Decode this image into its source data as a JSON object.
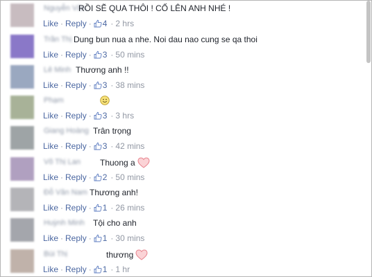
{
  "comments": [
    {
      "author": "Nguyễn Văn",
      "text": "RỒI SẼ QUA THÔI ! CỐ LÊN ANH NHÉ !",
      "like_label": "Like",
      "reply_label": "Reply",
      "likes": "4",
      "time": "2 hrs",
      "avatar_color": "#c8bcc0"
    },
    {
      "author": "Trần Thị",
      "text": "Dung bun nua a nhe. Noi dau nao cung se qa thoi",
      "like_label": "Like",
      "reply_label": "Reply",
      "likes": "3",
      "time": "50 mins",
      "avatar_color": "#8a78c8"
    },
    {
      "author": "Lê Minh",
      "text": "Thương anh !!",
      "like_label": "Like",
      "reply_label": "Reply",
      "likes": "3",
      "time": "38 mins",
      "avatar_color": "#9aa8c0"
    },
    {
      "author": "Phạm",
      "text": "",
      "emoji": "smile",
      "like_label": "Like",
      "reply_label": "Reply",
      "likes": "3",
      "time": "3 hrs",
      "avatar_color": "#a8b298"
    },
    {
      "author": "Giang Hoàng",
      "text": "Trân trọng",
      "like_label": "Like",
      "reply_label": "Reply",
      "likes": "3",
      "time": "42 mins",
      "avatar_color": "#9ea4a6"
    },
    {
      "author": "Võ Thị Lan",
      "text": "Thuong a",
      "emoji": "heart",
      "like_label": "Like",
      "reply_label": "Reply",
      "likes": "2",
      "time": "50 mins",
      "avatar_color": "#b0a0c0"
    },
    {
      "author": "Đỗ Văn Nam",
      "text": "Thương anh!",
      "like_label": "Like",
      "reply_label": "Reply",
      "likes": "1",
      "time": "26 mins",
      "avatar_color": "#b4b4b8"
    },
    {
      "author": "Huỳnh Minh",
      "text": "Tội cho anh",
      "like_label": "Like",
      "reply_label": "Reply",
      "likes": "1",
      "time": "30 mins",
      "avatar_color": "#a4a6ac"
    },
    {
      "author": "Bùi Thị",
      "text": "thương",
      "emoji": "heart",
      "like_label": "Like",
      "reply_label": "Reply",
      "likes": "1",
      "time": "1 hr",
      "avatar_color": "#c0b2aa"
    }
  ],
  "colors": {
    "link": "#4b67a1",
    "meta": "#9197a3",
    "text": "#1d2129",
    "heart": "#f0a0a8"
  }
}
